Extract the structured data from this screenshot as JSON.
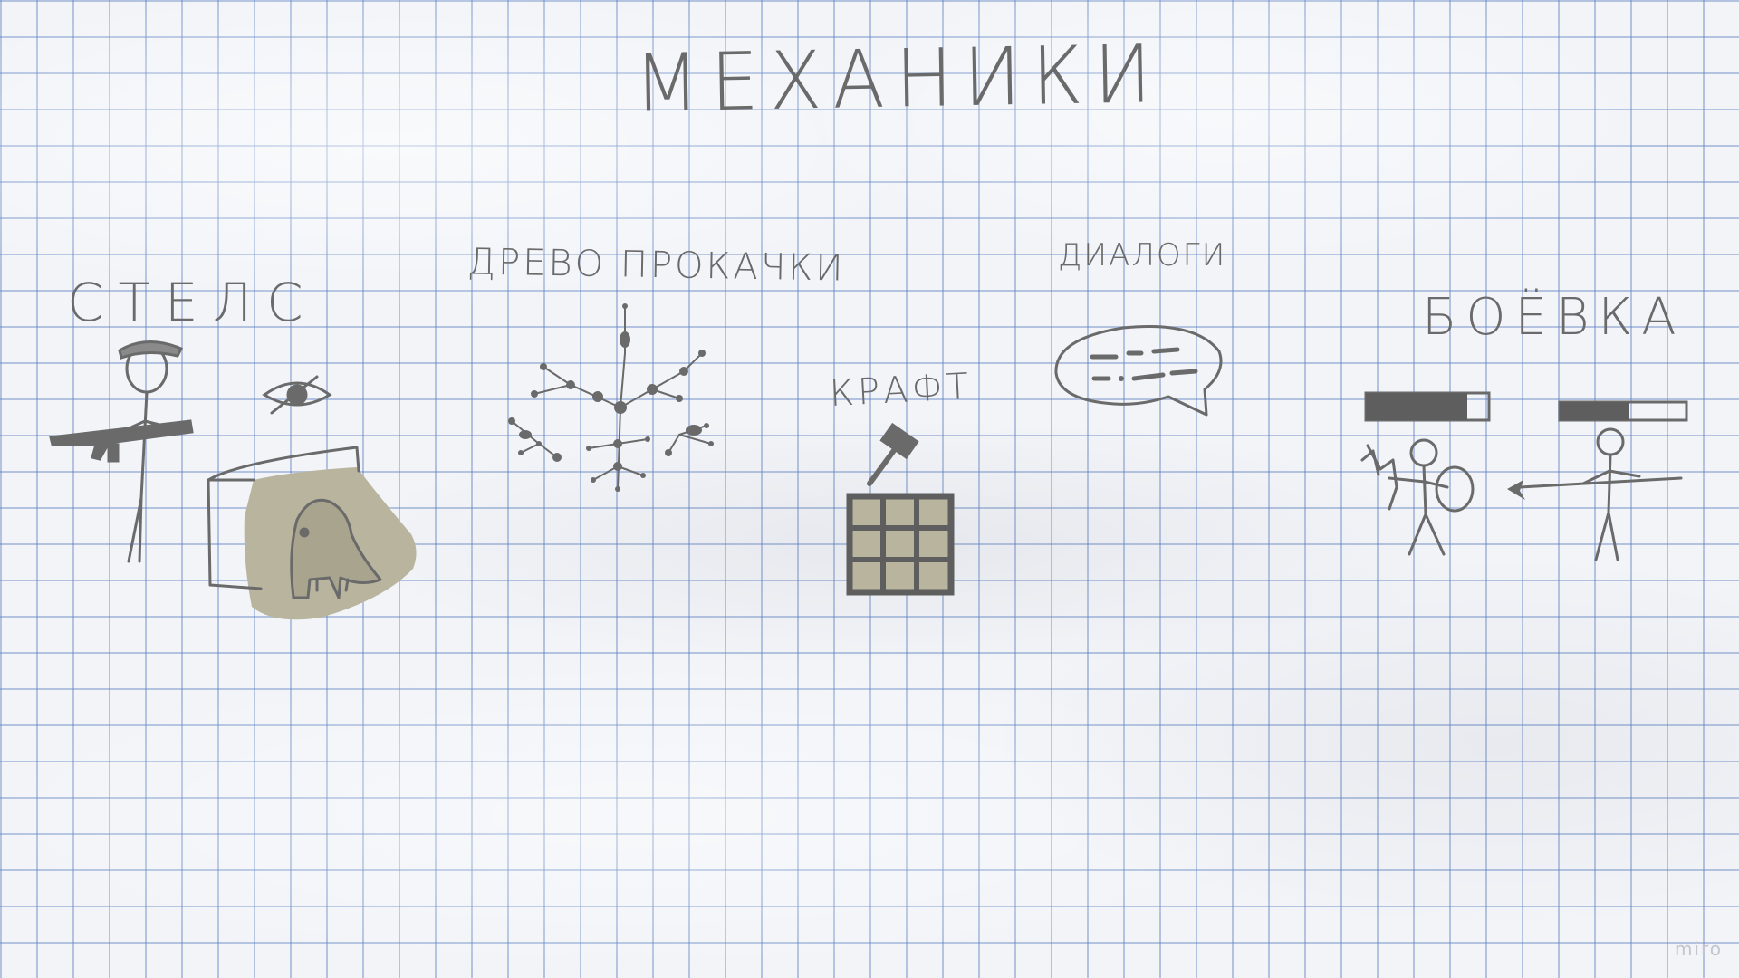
{
  "board": {
    "title": "МЕХАНИКИ",
    "watermark": "miro"
  },
  "sections": {
    "stealth": {
      "label": "СТЕЛС",
      "icons": [
        "soldier-icon",
        "crossed-eye-icon",
        "hiding-figure-icon"
      ]
    },
    "skill_tree": {
      "label": "ДРЕВО ПРОКАЧКИ",
      "icons": [
        "skill-tree-icon"
      ]
    },
    "craft": {
      "label": "КРАФТ",
      "icons": [
        "hammer-icon",
        "crafting-grid-icon"
      ]
    },
    "dialogues": {
      "label": "ДИАЛОГИ",
      "icons": [
        "speech-bubble-icon"
      ]
    },
    "combat": {
      "label": "БОЁВКА",
      "icons": [
        "health-bar-icon",
        "sword-shield-fighter-icon",
        "spear-fighter-icon"
      ]
    }
  },
  "colors": {
    "ink": "#6a6a6a",
    "fill": "#b8b49e",
    "grid": "#5a7dbe",
    "paper": "#f2f4f8"
  }
}
